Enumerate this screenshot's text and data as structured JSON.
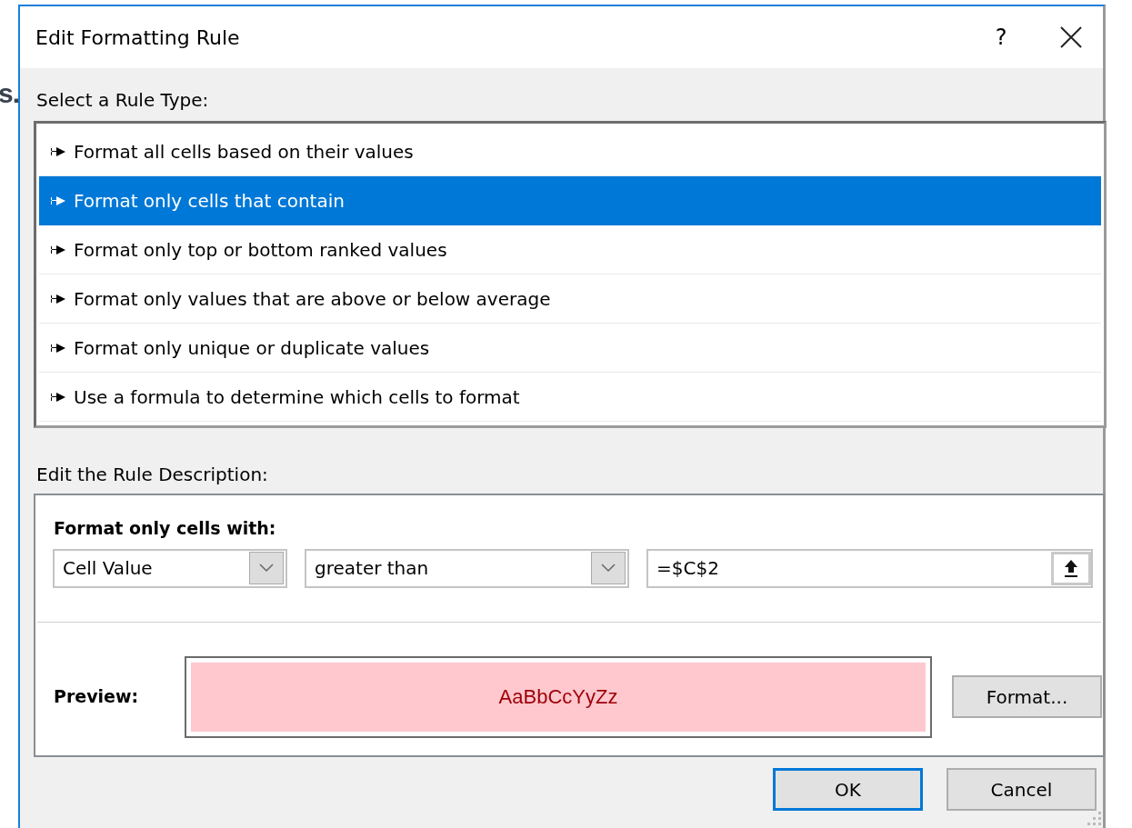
{
  "background_text": "s.",
  "dialog": {
    "title": "Edit Formatting Rule",
    "help_button": "?"
  },
  "rule_type": {
    "label": "Select a Rule Type:",
    "items": [
      {
        "label": "Format all cells based on their values",
        "selected": false
      },
      {
        "label": "Format only cells that contain",
        "selected": true
      },
      {
        "label": "Format only top or bottom ranked values",
        "selected": false
      },
      {
        "label": "Format only values that are above or below average",
        "selected": false
      },
      {
        "label": "Format only unique or duplicate values",
        "selected": false
      },
      {
        "label": "Use a formula to determine which cells to format",
        "selected": false
      }
    ]
  },
  "description": {
    "label": "Edit the Rule Description:",
    "heading": "Format only cells with:",
    "condition": {
      "operand": "Cell Value",
      "operator": "greater than",
      "value": "=$C$2"
    },
    "preview": {
      "label": "Preview:",
      "sample": "AaBbCcYyZz"
    },
    "format_button": {
      "label": "Format..."
    }
  },
  "buttons": [
    {
      "label": "OK",
      "default": true
    },
    {
      "label": "Cancel",
      "default": false
    }
  ]
}
